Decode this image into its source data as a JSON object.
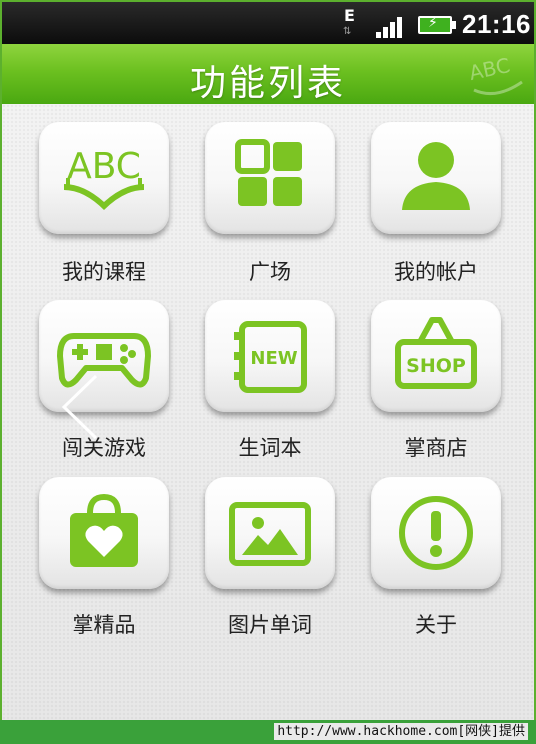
{
  "status_bar": {
    "network_type": "E",
    "time": "21:16",
    "icons": [
      "network-type-icon",
      "signal-icon",
      "battery-charging-icon"
    ]
  },
  "header": {
    "title": "功能列表",
    "watermark_text": "ABC"
  },
  "colors": {
    "accent": "#6cc020",
    "icon_green": "#7cc423",
    "footer": "#3aa13a"
  },
  "menu": {
    "items": [
      {
        "label": "我的课程",
        "icon": "book-abc-icon"
      },
      {
        "label": "广场",
        "icon": "grid-icon"
      },
      {
        "label": "我的帐户",
        "icon": "user-icon"
      },
      {
        "label": "闯关游戏",
        "icon": "gamepad-icon"
      },
      {
        "label": "生词本",
        "icon": "notebook-new-icon",
        "badge": "NEW"
      },
      {
        "label": "掌商店",
        "icon": "shop-bag-icon",
        "badge": "SHOP"
      },
      {
        "label": "掌精品",
        "icon": "heart-bag-icon"
      },
      {
        "label": "图片单词",
        "icon": "picture-icon"
      },
      {
        "label": "关于",
        "icon": "info-icon"
      }
    ]
  },
  "footer": {
    "text": "http://www.hackhome.com[网侠]提供"
  }
}
